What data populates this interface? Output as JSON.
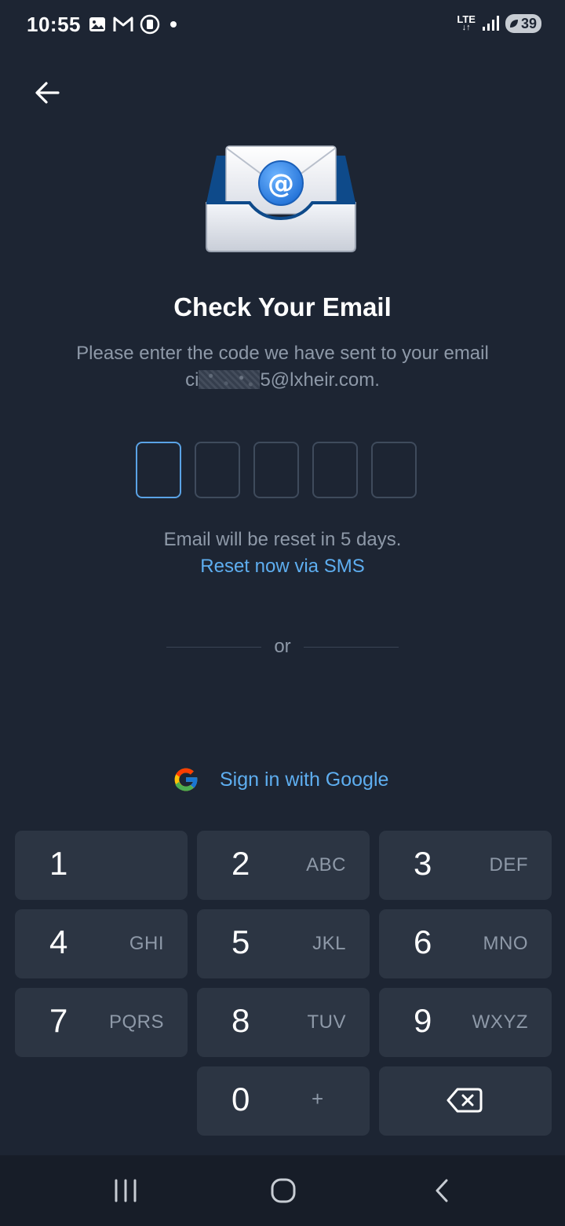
{
  "status_bar": {
    "time": "10:55",
    "network": "LTE",
    "battery": "39",
    "left_icons": [
      "image-icon",
      "gmail-icon",
      "stop-recording-icon",
      "notification-dot-icon"
    ],
    "right_icons": [
      "lte-icon",
      "signal-icon",
      "battery-icon"
    ]
  },
  "header": {
    "back_icon": "arrow-left-icon"
  },
  "illustration": {
    "icon": "email-inbox-icon",
    "accent": "#2a7fe0"
  },
  "main": {
    "title": "Check Your Email",
    "subtitle": "Please enter the code we have sent to your email",
    "email_prefix": "ci",
    "email_suffix": "5@lxheir.com.",
    "code_length": 5,
    "reset_info": "Email will be reset in 5 days.",
    "reset_link": "Reset now via SMS",
    "divider_text": "or",
    "google_label": "Sign in with Google"
  },
  "keypad": {
    "keys": [
      {
        "digit": "1",
        "letters": ""
      },
      {
        "digit": "2",
        "letters": "ABC"
      },
      {
        "digit": "3",
        "letters": "DEF"
      },
      {
        "digit": "4",
        "letters": "GHI"
      },
      {
        "digit": "5",
        "letters": "JKL"
      },
      {
        "digit": "6",
        "letters": "MNO"
      },
      {
        "digit": "7",
        "letters": "PQRS"
      },
      {
        "digit": "8",
        "letters": "TUV"
      },
      {
        "digit": "9",
        "letters": "WXYZ"
      },
      {
        "digit": "0",
        "letters": "+"
      }
    ],
    "backspace_icon": "backspace-icon"
  },
  "nav_bar": {
    "icons": [
      "recent-apps-icon",
      "home-icon",
      "back-icon"
    ]
  },
  "colors": {
    "background": "#1d2533",
    "key_background": "#2c3543",
    "accent_link": "#5eaef0",
    "active_box": "#5aa3e6",
    "muted_text": "#8e99a8"
  }
}
